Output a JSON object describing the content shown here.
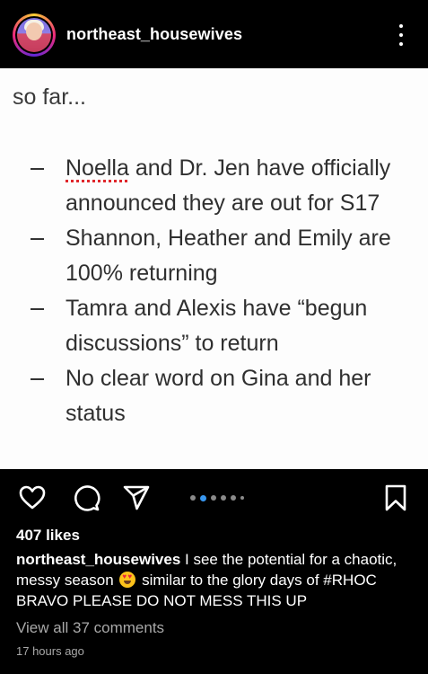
{
  "header": {
    "username": "northeast_housewives"
  },
  "post_image": {
    "intro": "so far...",
    "bullets": [
      {
        "first_word": "Noella",
        "rest": " and Dr. Jen have officially announced they are out for S17"
      },
      {
        "text": "Shannon, Heather and Emily are 100% returning"
      },
      {
        "text": "Tamra and Alexis have “begun discussions” to return"
      },
      {
        "text": "No clear word on Gina and her status"
      }
    ]
  },
  "carousel": {
    "total": 6,
    "active_index": 1
  },
  "likes": "407 likes",
  "caption": {
    "username": "northeast_housewives",
    "text_before_emoji": " I see the potential for a chaotic, messy season ",
    "emoji": "smiling-face-with-heart-eyes",
    "text_after_emoji": " similar to the glory days of #RHOC BRAVO PLEASE DO NOT MESS THIS UP"
  },
  "view_comments": "View all 37 comments",
  "timestamp": "17 hours ago",
  "colors": {
    "background": "#000000",
    "accent_blue": "#3897f0",
    "muted_text": "#a8a8a8",
    "spellcheck_red": "#e0262b"
  }
}
